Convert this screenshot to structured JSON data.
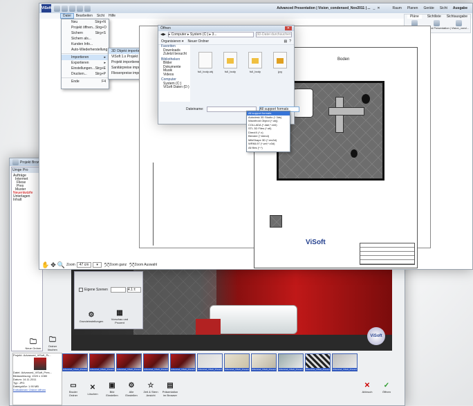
{
  "main": {
    "title": "Advanced Presentation | Vision_condensed_Nov2011 | ...",
    "ribbon_tabs": [
      "Raum",
      "Planen",
      "Geräte",
      "Sicht",
      "Ausgabe"
    ],
    "ribbon_sub_tabs": [
      "Pläne",
      "Sichtliste",
      "Sichtausgabe"
    ],
    "ribbon_sub_caption": "Advanced Presentation | Vision_cond...",
    "menu_tabs": [
      "Datei",
      "Bearbeiten",
      "Sicht",
      "Hilfe"
    ],
    "file_menu": [
      {
        "label": "Neu",
        "shortcut": "Strg+N"
      },
      {
        "label": "Projekt öffnen...",
        "shortcut": "Strg+O"
      },
      {
        "label": "Sichern",
        "shortcut": "Strg+S"
      },
      {
        "label": "Sichern als...",
        "shortcut": ""
      },
      {
        "label": "Kunden Info...",
        "shortcut": ""
      },
      {
        "label": "Auto-Wiederherstellung laden...",
        "shortcut": ""
      },
      {
        "label": "Importieren",
        "shortcut": "▸"
      },
      {
        "label": "Exportieren",
        "shortcut": "▸"
      },
      {
        "label": "Einstellungen...",
        "shortcut": "Strg+E"
      },
      {
        "label": "Drucken...",
        "shortcut": "Strg+P"
      },
      {
        "label": "Ende",
        "shortcut": "F4"
      }
    ],
    "import_submenu": [
      "3D Objekt importieren...",
      "ViSoft 1.x Projekt importieren...",
      "Projekt importieren aus Archiv...",
      "Sanitärpreise importieren...",
      "Fliesenpreise importieren..."
    ],
    "plan_title": "Boden",
    "bottom_toolbar": {
      "zoom_label": "Zoom",
      "zoom_value": "47 cm",
      "zoom_all": "Zoom ganz",
      "zoom_sel": "Zoom Auswahl"
    }
  },
  "dialog": {
    "title": "Öffnen",
    "breadcrumb": "▸ Computer ▸ System (C:) ▸ 3...",
    "search_placeholder": "3D-Datei durchsuchen",
    "organize": "Organisieren ▾",
    "new_folder": "Neuer Ordner",
    "nav": [
      "Favoriten",
      "Downloads",
      "Zuletzt besucht",
      "Bibliotheken",
      "Bilder",
      "Dokumente",
      "Musik",
      "Videos",
      "Computer",
      "System (C:)",
      "ViSoft Daten (D:)"
    ],
    "files": [
      "full_body.obj",
      "full_body",
      "full_body",
      "jpg"
    ],
    "filename_label": "Dateiname:",
    "filetype_selected": "All support formats",
    "filetype_options": [
      "All support formats",
      "Autodesk 3D Studio (*.3ds)",
      "Wavefront Object (*.obj)",
      "COLLADA (*.dae;*.xml)",
      "STL 3D Files (*.stl)",
      "DirectX (*.x)",
      "Blender (*.blend)",
      "MilkShape 3D (*.ms3d)",
      "WRML97 (*.wrl;*.x3d)",
      "All files (*.*)"
    ]
  },
  "project_window": {
    "title": "Projekt Browser",
    "tabs": [
      "Umge Pro"
    ],
    "tree": [
      "Aufträge",
      "Intermet",
      "Fliese",
      "Pres",
      "Muster",
      "Neuentwürfe",
      "Unterlagen",
      "Inhalt"
    ],
    "panel": {
      "label": "Eigene Szenen",
      "values": [
        "",
        "4.1 ±"
      ],
      "buttons": [
        "Grundeinstellungen",
        "Vorschau und Prozent"
      ]
    },
    "left_icons": [
      "Neue Ordner",
      "Ordner löschen"
    ],
    "info": [
      {
        "label": "Projekt:",
        "value": "Advanced_ViSoft_Pr..."
      },
      {
        "label": "Datei:",
        "value": "Advanced_ViSoft_Pres..."
      },
      {
        "label": "Bildauslösung:",
        "value": "1920 x 1080"
      },
      {
        "label": "Datum:",
        "value": "14.11.2011"
      },
      {
        "label": "Typ:",
        "value": "JPG"
      },
      {
        "label": "Dateigröße:",
        "value": "1.90 MB"
      }
    ],
    "open_folder_link": "Enthaltenen Ordner öffnen",
    "thumbs": [
      "Advanced_ViSoft_Presentation1",
      "Advanced_ViSoft_Presentation2",
      "Advanced_ViSoft_Presentation3",
      "Advanced_ViSoft_Presentation4",
      "Advanced_ViSoft_Presentation5",
      "Advanced_ViSoft_Presentation6",
      "Advanced_ViSoft_Presentation7",
      "Advanced_ViSoft_Presentation8",
      "Advanced_ViSoft_Presentation9",
      "Advanced_ViSoft_Presentation10",
      "Advanced_ViSoft_Presentation11"
    ],
    "toolbar": [
      "Bruder Ordner",
      "Löschen",
      "Bild Einstellen",
      "Alle Einstellen",
      "Zeit & Stern Ansicht",
      "Präsentation im Browser"
    ],
    "abort": "Abbruch",
    "open": "Öffnen"
  },
  "colors": {
    "accent": "#2752c2",
    "highlight": "#cfe3f8",
    "red_scene": "#b71c1c"
  }
}
